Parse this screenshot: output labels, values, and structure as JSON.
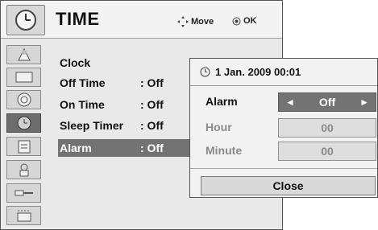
{
  "header": {
    "title": "TIME",
    "move_hint": "Move",
    "ok_hint": "OK"
  },
  "sidebar": {
    "icons": [
      {
        "name": "picture-icon"
      },
      {
        "name": "screen-icon"
      },
      {
        "name": "audio-icon"
      },
      {
        "name": "time-icon",
        "active": true
      },
      {
        "name": "lock-icon"
      },
      {
        "name": "option-icon"
      },
      {
        "name": "input-icon"
      },
      {
        "name": "usb-icon"
      }
    ]
  },
  "menu": {
    "items": [
      {
        "label": "Clock",
        "value": ""
      },
      {
        "label": "Off Time",
        "value": ": Off"
      },
      {
        "label": "On Time",
        "value": ": Off"
      },
      {
        "label": "Sleep Timer",
        "value": ": Off"
      },
      {
        "label": "Alarm",
        "value": ": Off",
        "selected": true
      }
    ]
  },
  "popup": {
    "datetime": "1 Jan. 2009 00:01",
    "rows": [
      {
        "label": "Alarm",
        "value": "Off"
      },
      {
        "label": "Hour",
        "value": "00"
      },
      {
        "label": "Minute",
        "value": "00"
      }
    ],
    "close_label": "Close",
    "left_arrow": "◄",
    "right_arrow": "►"
  },
  "colors": {
    "selected_bg": "#737373",
    "menu_bg": "#e9e9e9",
    "popup_bg": "#f2f2f2"
  }
}
